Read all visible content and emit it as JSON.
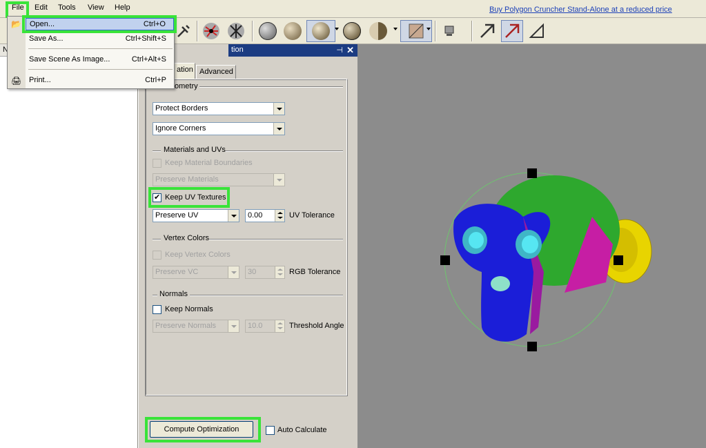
{
  "menubar": {
    "items": [
      "File",
      "Edit",
      "Tools",
      "View",
      "Help"
    ],
    "buy_link": "Buy Polygon Cruncher Stand-Alone at a reduced price"
  },
  "file_menu": {
    "items": [
      {
        "label": "Open...",
        "shortcut": "Ctrl+O"
      },
      {
        "label": "Save As...",
        "shortcut": "Ctrl+Shift+S"
      },
      {
        "label": "Save Scene As Image...",
        "shortcut": "Ctrl+Alt+S"
      },
      {
        "label": "Print...",
        "shortcut": "Ctrl+P"
      }
    ]
  },
  "tree": {
    "header": "N"
  },
  "panel": {
    "title": "tion",
    "tabs": [
      "ation",
      "Advanced"
    ],
    "geometry": {
      "label": "ometry",
      "border_mode": "Protect Borders",
      "corner_mode": "Ignore Corners"
    },
    "materials": {
      "label": "Materials and UVs",
      "keep_material_boundaries": "Keep Material Boundaries",
      "preserve_materials": "Preserve Materials",
      "keep_uv_textures": "Keep UV Textures",
      "preserve_uv": "Preserve UV",
      "uv_tolerance_value": "0.00",
      "uv_tolerance_label": "UV Tolerance"
    },
    "vertex_colors": {
      "label": "Vertex Colors",
      "keep_vertex_colors": "Keep Vertex Colors",
      "preserve_vc": "Preserve VC",
      "rgb_tolerance_value": "30",
      "rgb_tolerance_label": "RGB Tolerance"
    },
    "normals": {
      "label": "Normals",
      "keep_normals": "Keep Normals",
      "preserve_normals": "Preserve Normals",
      "threshold_value": "10.0",
      "threshold_label": "Threshold Angle"
    },
    "compute_button": "Compute Optimization",
    "auto_calculate": "Auto Calculate"
  },
  "colors": {
    "highlight": "#39e339",
    "title_bar": "#1c3c82",
    "viewport_bg": "#8c8c8c",
    "link": "#1a3fb8"
  }
}
